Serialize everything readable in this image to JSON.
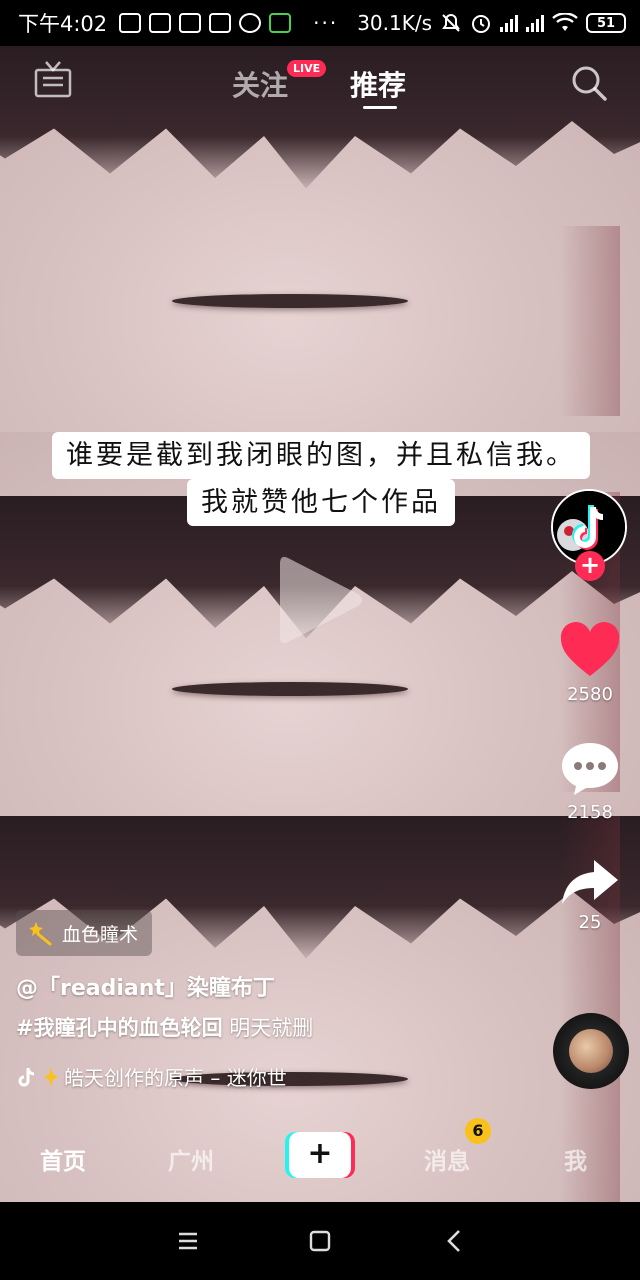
{
  "status_bar": {
    "time": "下午4:02",
    "dots": "···",
    "speed": "30.1K/s",
    "battery": "51"
  },
  "top_nav": {
    "live_room_label": "直播",
    "tab_follow": "关注",
    "live_badge": "LIVE",
    "tab_recommend": "推荐"
  },
  "video": {
    "caption_line1": "谁要是截到我闭眼的图，并且私信我。",
    "caption_line2": "我就赞他七个作品"
  },
  "right_rail": {
    "likes": "2580",
    "comments": "2158",
    "shares": "25"
  },
  "info": {
    "effect_name": "血色瞳术",
    "author": "@「readiant」染瞳布丁",
    "hashtag": "#我瞳孔中的血色轮回",
    "desc_text": " 明天就删",
    "music": "皓天创作的原声 – 迷你世"
  },
  "tab_bar": {
    "home": "首页",
    "city": "广州",
    "plus": "+",
    "messages": "消息",
    "messages_badge": "6",
    "me": "我"
  },
  "colors": {
    "accent_red": "#fe2c55",
    "accent_cyan": "#25f4ee",
    "badge_yellow": "#f8c21a"
  }
}
